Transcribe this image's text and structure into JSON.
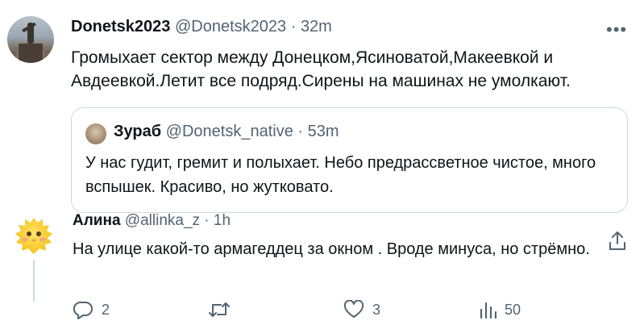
{
  "main_post": {
    "display_name": "Donetsk2023",
    "handle": "@Donetsk2023",
    "separator": "·",
    "time": "32m",
    "text": "Громыхает сектор между Донецком,Ясиноватой,Макеевкой и Авдеевкой.Летит все подряд.Сирены на машинах не умолкают."
  },
  "quoted_post": {
    "display_name": "Зураб",
    "handle": "@Donetsk_native",
    "separator": "·",
    "time": "53m",
    "text": "У нас гудит, гремит и полыхает. Небо предрассветное чистое, много вспышек. Красиво, но жутковато."
  },
  "reply_post": {
    "display_name": "Алина",
    "handle": "@allinka_z",
    "separator": "·",
    "time": "1h",
    "text": "На улице какой-то армагеддец за окном . Вроде минуса, но стрёмно."
  },
  "actions": {
    "replies": "2",
    "retweets": "",
    "likes": "3",
    "views": "50"
  },
  "icons": {
    "more": "more-icon",
    "reply": "reply-icon",
    "retweet": "retweet-icon",
    "like": "heart-icon",
    "views": "views-icon",
    "share": "share-icon"
  },
  "colors": {
    "text": "#0f1419",
    "secondary": "#536471",
    "border": "#cfd9de"
  }
}
